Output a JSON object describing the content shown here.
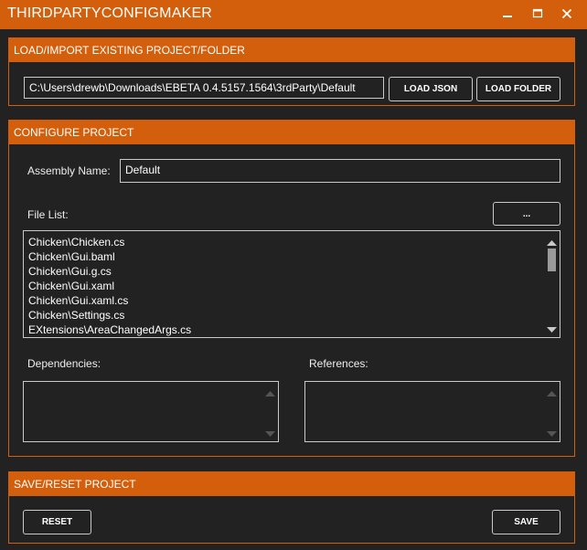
{
  "window": {
    "title": "THIRDPARTYCONFIGMAKER",
    "minimize_icon": "minimize-icon",
    "maximize_icon": "maximize-icon",
    "close_icon": "close-icon"
  },
  "colors": {
    "accent": "#d35f0c",
    "background": "#222222",
    "border": "#c9c9c9",
    "text": "#ffffff"
  },
  "load_section": {
    "title": "LOAD/IMPORT EXISTING PROJECT/FOLDER",
    "path_value": "C:\\Users\\drewb\\Downloads\\EBETA 0.4.5157.1564\\3rdParty\\Default",
    "load_json_label": "LOAD JSON",
    "load_folder_label": "LOAD FOLDER"
  },
  "configure_section": {
    "title": "CONFIGURE PROJECT",
    "assembly_name_label": "Assembly Name:",
    "assembly_name_value": "Default",
    "file_list_label": "File List:",
    "browse_label": "...",
    "files": [
      "Chicken\\Chicken.cs",
      "Chicken\\Gui.baml",
      "Chicken\\Gui.g.cs",
      "Chicken\\Gui.xaml",
      "Chicken\\Gui.xaml.cs",
      "Chicken\\Settings.cs",
      "EXtensions\\AreaChangedArgs.cs"
    ],
    "dependencies_label": "Dependencies:",
    "references_label": "References:"
  },
  "save_section": {
    "title": "SAVE/RESET PROJECT",
    "reset_label": "RESET",
    "save_label": "SAVE"
  }
}
